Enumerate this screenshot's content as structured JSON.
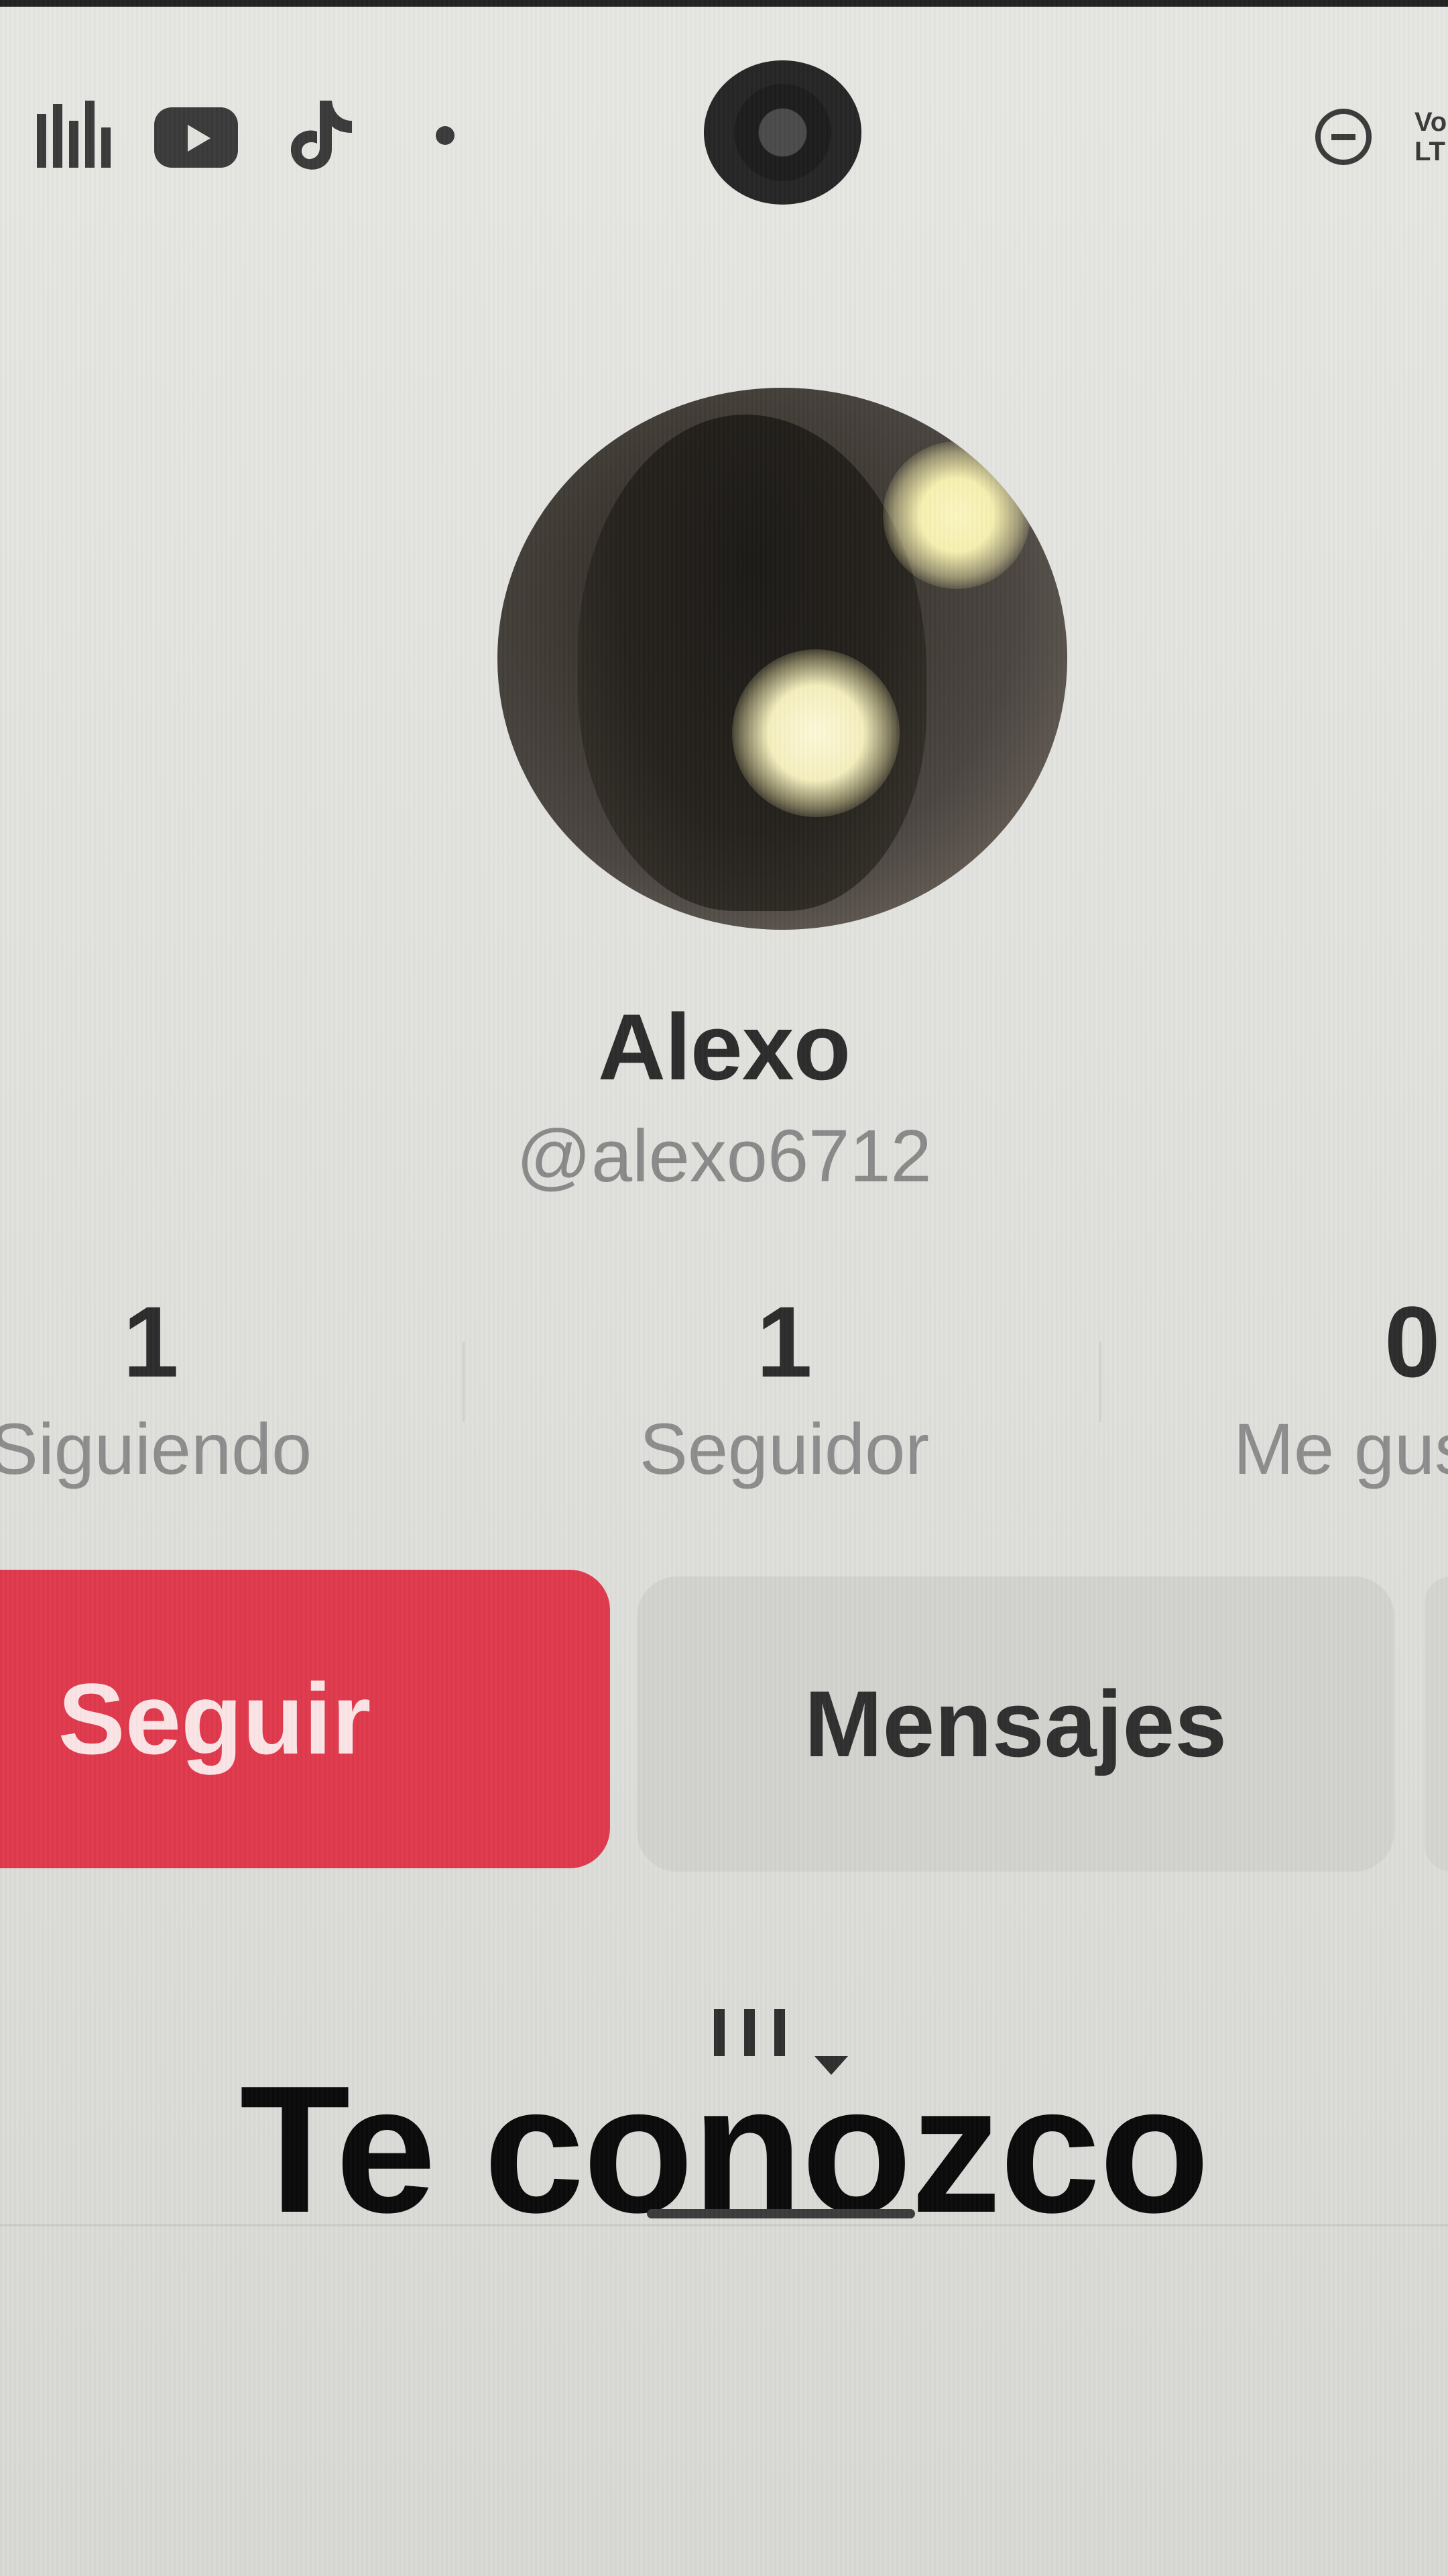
{
  "status_bar": {
    "icons": [
      "equalizer-icon",
      "youtube-icon",
      "tiktok-icon",
      "notification-dot-icon",
      "do-not-disturb-icon"
    ],
    "carrier_text": "Vo\nLT"
  },
  "profile": {
    "display_name": "Alexo",
    "username": "@alexo6712",
    "stats": {
      "following": {
        "value": "1",
        "label": "Siguiendo"
      },
      "followers": {
        "value": "1",
        "label": "Seguidor"
      },
      "likes": {
        "value": "0",
        "label": "Me gusta"
      }
    }
  },
  "actions": {
    "follow_label": "Seguir",
    "message_label": "Mensajes",
    "follow_color": "#e0394d"
  },
  "overlay": {
    "caption": "Te conozco"
  }
}
